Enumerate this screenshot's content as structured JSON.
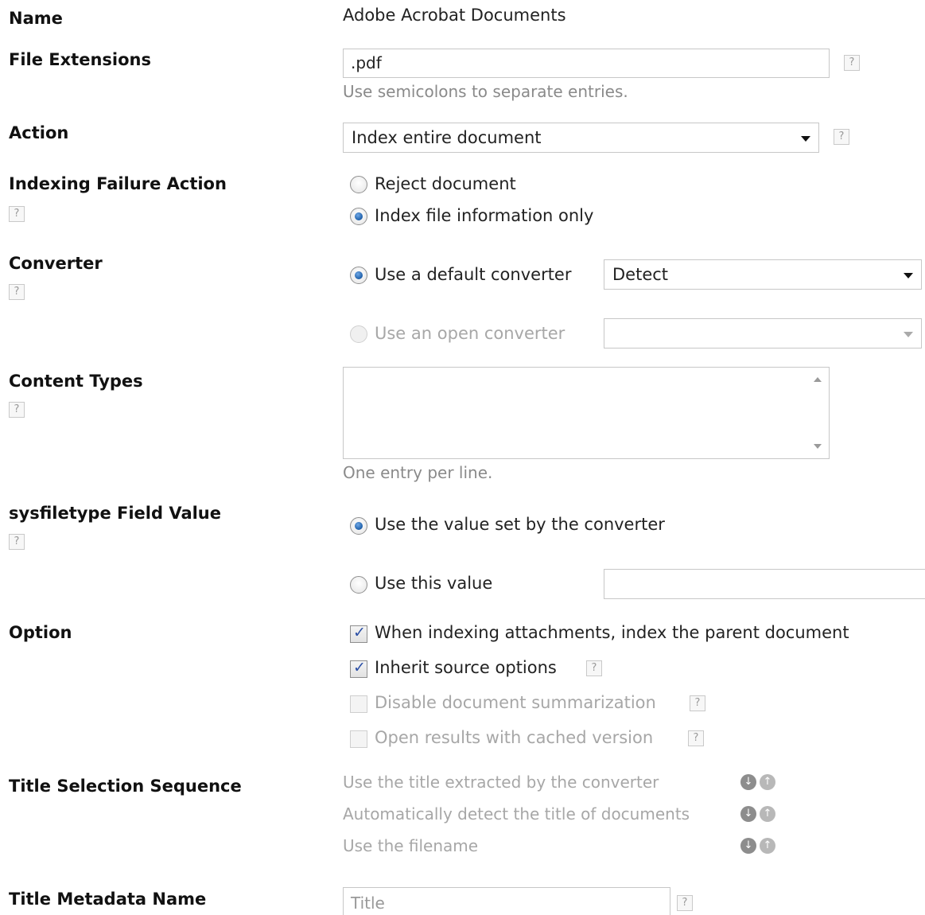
{
  "labels": {
    "name": "Name",
    "file_extensions": "File Extensions",
    "action": "Action",
    "indexing_failure_action": "Indexing Failure Action",
    "converter": "Converter",
    "content_types": "Content Types",
    "sysfiletype_field_value": "sysfiletype Field Value",
    "option": "Option",
    "title_selection_sequence": "Title Selection Sequence",
    "title_metadata_name": "Title Metadata Name"
  },
  "help_glyph": "?",
  "name_value": "Adobe Acrobat Documents",
  "file_extensions": {
    "value": ".pdf",
    "hint": "Use semicolons to separate entries."
  },
  "action": {
    "selected": "Index entire document"
  },
  "indexing_failure": {
    "reject_label": "Reject document",
    "index_info_label": "Index file information only",
    "selected": "index_info"
  },
  "converter": {
    "default_label": "Use a default converter",
    "default_selected_value": "Detect",
    "open_label": "Use an open converter",
    "open_selected_value": ""
  },
  "content_types": {
    "value": "",
    "hint": "One entry per line."
  },
  "sysfiletype": {
    "converter_value_label": "Use the value set by the converter",
    "this_value_label": "Use this value",
    "this_value_input": ""
  },
  "options": {
    "attachments_label": "When indexing attachments, index the parent document",
    "attachments_checked": true,
    "inherit_label": "Inherit source options",
    "inherit_checked": true,
    "disable_summary_label": "Disable document summarization",
    "disable_summary_checked": false,
    "cached_label": "Open results with cached version",
    "cached_checked": false
  },
  "title_sequence": [
    "Use the title extracted by the converter",
    "Automatically detect the title of documents",
    "Use the filename"
  ],
  "title_metadata": {
    "placeholder": "Title"
  },
  "colors": {
    "radio_selected": "#1d5ea8",
    "check_mark": "#2b4fa6",
    "disabled_text": "#a7a7a7"
  }
}
